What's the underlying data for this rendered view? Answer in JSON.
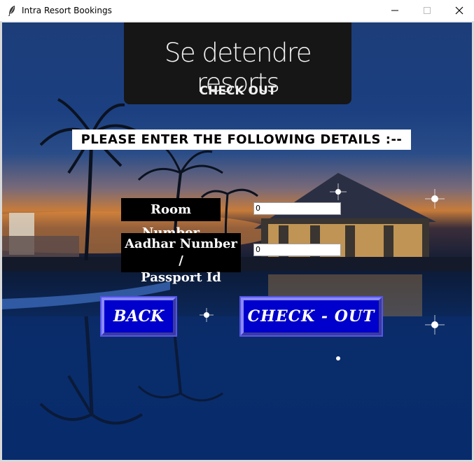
{
  "window": {
    "title": "Intra Resort Bookings"
  },
  "banner": {
    "title": "Se detendre resorts",
    "subtitle": "CHECK OUT"
  },
  "instruction": "PLEASE ENTER THE FOLLOWING DETAILS :--",
  "form": {
    "room_label": "Room Number",
    "room_value": "0",
    "aadhar_label_line1": "Aadhar Number /",
    "aadhar_label_line2": "Passport Id",
    "aadhar_value": "0"
  },
  "buttons": {
    "back_label": "BACK",
    "checkout_label": "CHECK - OUT"
  },
  "colors": {
    "button_bg": "#0000cc",
    "label_bg": "#000000",
    "banner_bg": "#161616"
  },
  "icons": {
    "app_icon": "feather-icon",
    "minimize": "minimize-icon",
    "maximize": "maximize-icon",
    "close": "close-icon"
  }
}
